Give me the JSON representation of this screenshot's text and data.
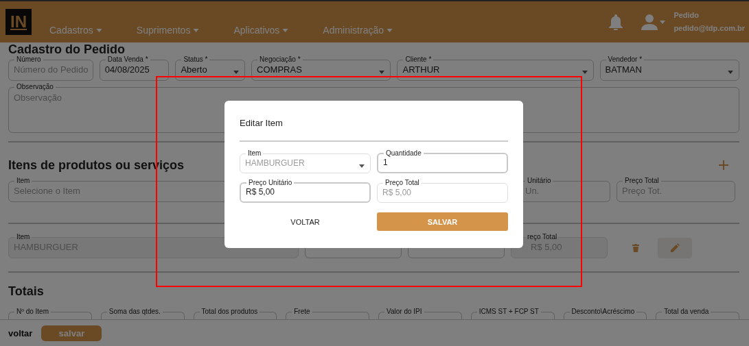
{
  "header": {
    "logo_text": "IN",
    "nav": [
      {
        "label": "Cadastros"
      },
      {
        "label": "Suprimentos"
      },
      {
        "label": "Aplicativos"
      },
      {
        "label": "Administração"
      }
    ],
    "user": {
      "name": "Pedido",
      "email": "pedido@tdp.com.br"
    }
  },
  "page": {
    "title": "Cadastro do Pedido",
    "order_fields": [
      {
        "label": "Número",
        "placeholder": "Número do Pedido",
        "kind": "text"
      },
      {
        "label": "Data Venda *",
        "value": "04/08/2025",
        "kind": "text"
      },
      {
        "label": "Status *",
        "value": "Aberto",
        "kind": "select"
      },
      {
        "label": "Negociação *",
        "value": "COMPRAS",
        "kind": "select"
      },
      {
        "label": "Cliente *",
        "value": "ARTHUR",
        "kind": "select"
      },
      {
        "label": "Vendedor *",
        "value": "BATMAN",
        "kind": "select"
      }
    ],
    "observation": {
      "label": "Observação",
      "placeholder": "Observação"
    },
    "items_title": "Itens de produtos ou serviços",
    "new_item_fields": [
      {
        "label": "Item",
        "placeholder": "Selecione o Item",
        "kind": "text"
      },
      {
        "label": "Unitário",
        "placeholder": "Un.",
        "kind": "text"
      },
      {
        "label": "Preço Total",
        "placeholder": "Preço Tot.",
        "kind": "text"
      }
    ],
    "item_rows": [
      {
        "fields": [
          {
            "label": "Item",
            "value": "HAMBURGUER",
            "kind": "text",
            "disabled": true
          },
          {
            "kind": "text"
          },
          {
            "kind": "text"
          },
          {
            "label": "reço Total",
            "value": "R$ 5,00",
            "kind": "text",
            "disabled": true
          }
        ]
      }
    ],
    "totals_title": "Totais",
    "totals_fields": [
      "Nº do Item",
      "Soma das qtdes.",
      "Total dos produtos",
      "Frete",
      "Valor do IPI",
      "ICMS ST + FCP ST",
      "Desconto\\Acréscimo",
      "Total da venda"
    ]
  },
  "footer": {
    "back": "voltar",
    "save": "salvar"
  },
  "modal": {
    "title": "Editar Item",
    "fields": [
      {
        "label": "Item",
        "value": "HAMBURGUER",
        "kind": "select",
        "disabled": true
      },
      {
        "label": "Quantidade",
        "value": "1",
        "kind": "text",
        "disabled": false
      },
      {
        "label": "Preço Unitário",
        "value": "R$ 5,00",
        "kind": "text",
        "disabled": false
      },
      {
        "label": "Preço Total",
        "value": "R$ 5,00",
        "kind": "text",
        "disabled": true
      }
    ],
    "buttons": [
      {
        "label": "VOLTAR",
        "kind": "text"
      },
      {
        "label": "SALVAR",
        "kind": "primary"
      }
    ]
  }
}
